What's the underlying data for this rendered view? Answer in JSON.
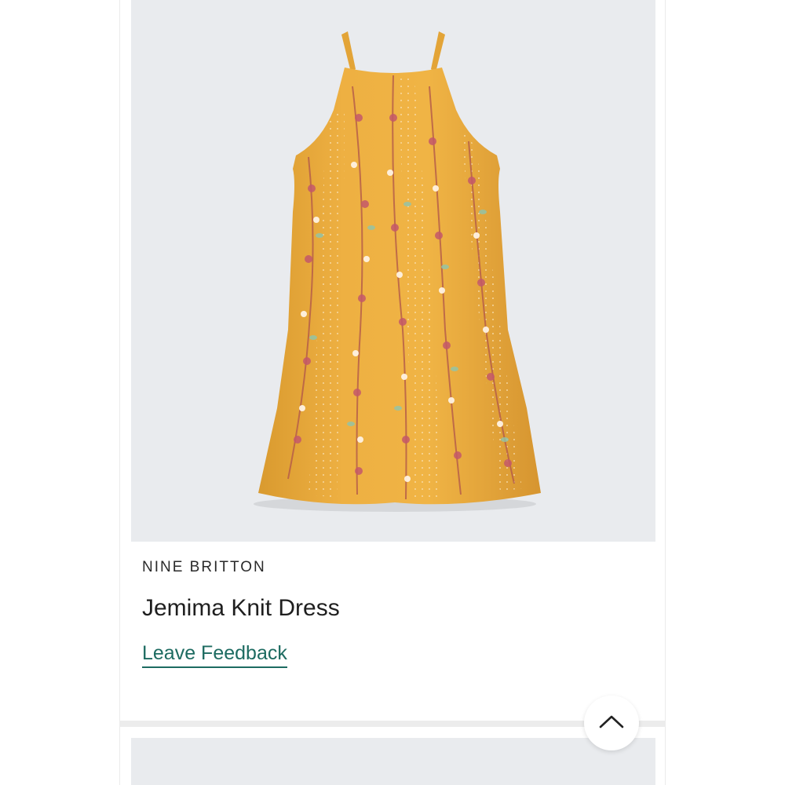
{
  "product": {
    "brand": "NINE BRITTON",
    "name": "Jemima Knit Dress",
    "feedback_link": "Leave Feedback",
    "image_icon": "floral-dress-image"
  },
  "controls": {
    "scroll_top_icon": "chevron-up-icon"
  },
  "colors": {
    "accent": "#1d6b61",
    "image_background": "#e9ebee",
    "dress": "#e8a93a"
  }
}
